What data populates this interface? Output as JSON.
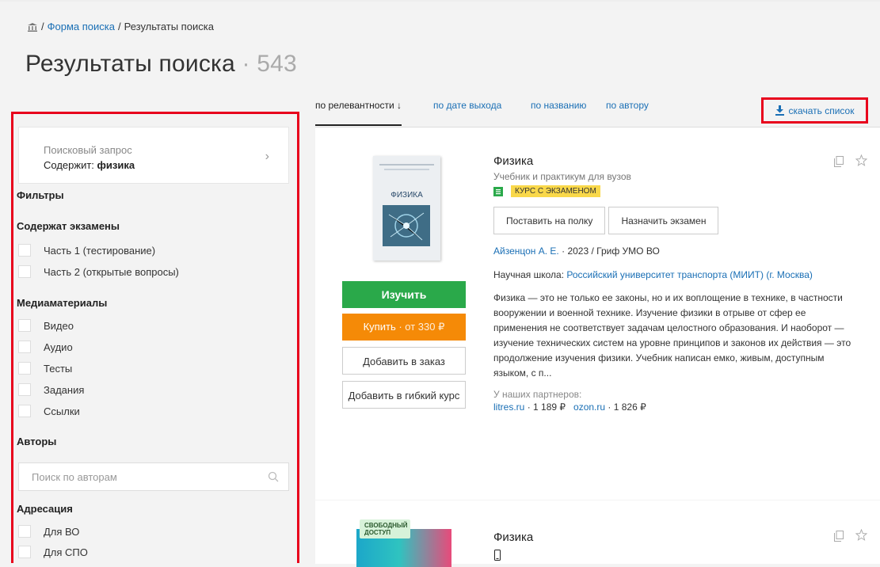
{
  "breadcrumb": {
    "sep": "/",
    "search_form": "Форма поиска",
    "results": "Результаты поиска"
  },
  "page": {
    "title": "Результаты поиска",
    "dot": "·",
    "count": "543"
  },
  "query": {
    "label": "Поисковый запрос",
    "contains": "Содержит:",
    "value": "физика"
  },
  "filters": {
    "title": "Фильтры",
    "exams": {
      "title": "Содержат экзамены",
      "items": [
        "Часть 1 (тестирование)",
        "Часть 2 (открытые вопросы)"
      ]
    },
    "media": {
      "title": "Медиаматериалы",
      "items": [
        "Видео",
        "Аудио",
        "Тесты",
        "Задания",
        "Ссылки"
      ]
    },
    "authors": {
      "title": "Авторы",
      "placeholder": "Поиск по авторам"
    },
    "audience": {
      "title": "Адресация",
      "items": [
        "Для ВО",
        "Для СПО"
      ]
    }
  },
  "sort": {
    "relevance": "по релевантности ↓",
    "date": "по дате выхода",
    "name": "по названию",
    "author": "по автору",
    "download": "скачать список"
  },
  "results": [
    {
      "cover_title": "ФИЗИКА",
      "title": "Физика",
      "subtitle": "Учебник и практикум для вузов",
      "badge": "КУРС С ЭКЗАМЕНОМ",
      "btn_learn": "Изучить",
      "btn_buy": "Купить",
      "btn_buy_price": "· от 330 ₽",
      "btn_order": "Добавить в заказ",
      "btn_flex": "Добавить в гибкий курс",
      "action_shelf": "Поставить на полку",
      "action_exam": "Назначить экзамен",
      "author": "Айзенцон А. Е.",
      "year_grif": "· 2023 / Гриф УМО ВО",
      "school_label": "Научная школа:",
      "school": "Российский университет транспорта (МИИТ) (г. Москва)",
      "description": "Физика — это не только ее законы, но и их воплощение в технике, в частности вооружении и военной технике. Изучение физики в отрыве от сфер ее применения не соответствует задачам целостного образования. И наоборот — изучение технических систем на уровне принципов и законов их действия — это продолжение изучения физики. Учебник написан емко, живым, доступным языком, с п...",
      "partners_label": "У наших партнеров:",
      "partner1": "litres.ru",
      "partner1_price": "· 1 189 ₽",
      "partner2": "ozon.ru",
      "partner2_price": "· 1 826 ₽"
    },
    {
      "free_badge": "СВОБОДНЫЙ ДОСТУП",
      "title": "Физика"
    }
  ],
  "colors": {
    "highlight_border": "#e8001c",
    "link": "#1a6fb5",
    "learn_button": "#2aa94a",
    "buy_button": "#f58a07",
    "badge": "#f9d84a"
  },
  "icons": [
    "home-icon",
    "chevron-right-icon",
    "search-icon",
    "download-icon",
    "copy-icon",
    "star-icon",
    "course-icon",
    "phone-icon"
  ]
}
